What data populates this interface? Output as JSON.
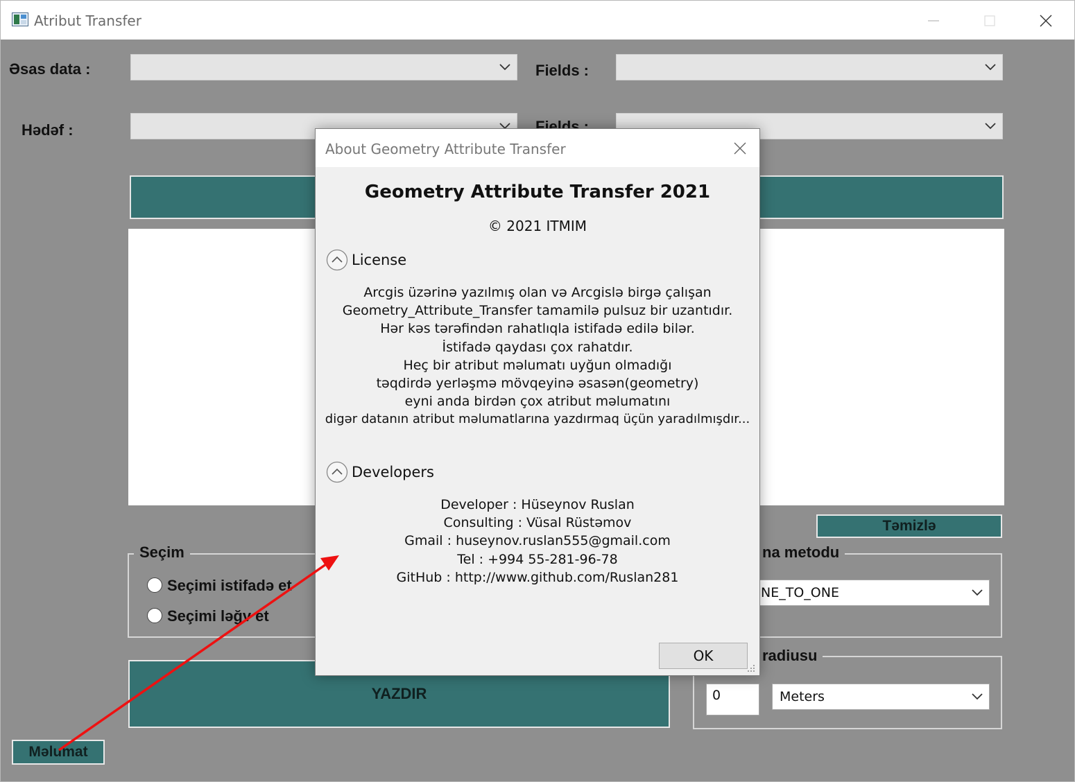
{
  "window": {
    "title": "Atribut Transfer",
    "controls": {
      "minimize": "minimize-icon",
      "maximize": "maximize-icon",
      "close": "close-icon"
    }
  },
  "form": {
    "main_data_label": "Əsas data :",
    "target_label": "Hədəf :",
    "fields_label_1": "Fields :",
    "fields_label_2": "Fields :",
    "clear_button": "Təmizlə",
    "selection_group": {
      "title": "Seçim",
      "option_use": "Seçimi istifadə et",
      "option_cancel": "Seçimi ləğv et"
    },
    "method_group": {
      "title_visible": "na metodu",
      "selected": "NE_TO_ONE"
    },
    "radius_group": {
      "title_visible": "radiusu",
      "value": "0",
      "unit": "Meters"
    },
    "write_button": "YAZDIR",
    "info_button": "Məlumat"
  },
  "about_dialog": {
    "title": "About Geometry Attribute Transfer",
    "heading": "Geometry Attribute Transfer 2021",
    "copyright": "© 2021 ITMIM",
    "license_label": "License",
    "license_lines": [
      "Arcgis üzərinə yazılmış olan və Arcgislə birgə çalışan",
      "Geometry_Attribute_Transfer tamamilə  pulsuz bir uzantıdır.",
      "Hər kəs tərəfindən rahatlıqla istifadə edilə bilər.",
      "İstifadə qaydası çox rahatdır.",
      "Heç bir atribut məlumatı uyğun olmadığı",
      "təqdirdə yerləşmə mövqeyinə əsasən(geometry)",
      "eyni anda birdən çox atribut məlumatını",
      "digər datanın atribut məlumatlarına yazdırmaq üçün yaradılmışdır..."
    ],
    "developers_label": "Developers",
    "developer_lines": [
      "Developer : Hüseynov Ruslan",
      "Consulting : Vüsal Rüstəmov",
      "Gmail : huseynov.ruslan555@gmail.com",
      "Tel : +994 55-281-96-78",
      "GitHub : http://www.github.com/Ruslan281"
    ],
    "ok_button": "OK"
  },
  "colors": {
    "window_bg": "#8f8f8f",
    "teal": "#357272",
    "dialog_bg": "#f0f0f0",
    "annotation_arrow": "#ee1111"
  }
}
